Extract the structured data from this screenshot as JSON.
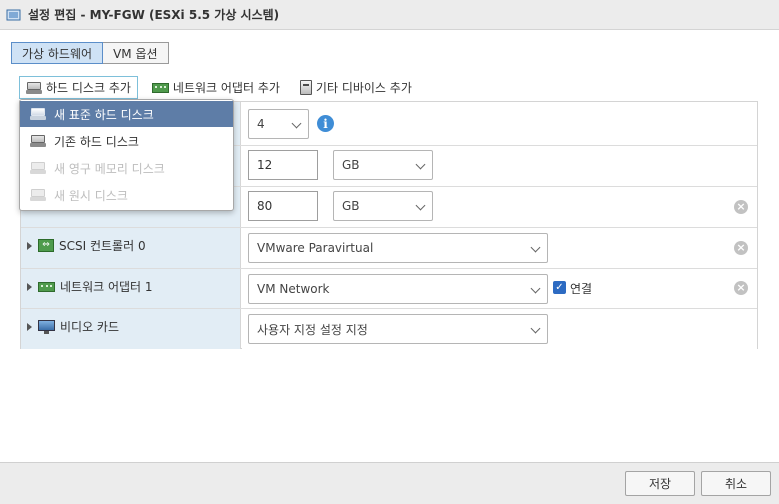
{
  "window": {
    "title": "설정 편집 - MY-FGW (ESXi 5.5 가상 시스템)"
  },
  "tabs": [
    {
      "label": "가상 하드웨어",
      "active": true
    },
    {
      "label": "VM 옵션",
      "active": false
    }
  ],
  "toolbar": {
    "add_disk": "하드 디스크 추가",
    "add_nic": "네트워크 어댑터 추가",
    "add_other": "기타 디바이스 추가"
  },
  "dropdown": {
    "items": [
      {
        "label": "새 표준 하드 디스크",
        "state": "highlighted"
      },
      {
        "label": "기존 하드 디스크",
        "state": "enabled"
      },
      {
        "label": "새 영구 메모리 디스크",
        "state": "disabled"
      },
      {
        "label": "새 원시 디스크",
        "state": "disabled"
      }
    ]
  },
  "rows": {
    "cpu": {
      "value": "4"
    },
    "memory": {
      "value": "12",
      "unit": "GB"
    },
    "disk": {
      "value": "80",
      "unit": "GB"
    },
    "scsi": {
      "label": "SCSI 컨트롤러 0",
      "value": "VMware Paravirtual"
    },
    "nic": {
      "label": "네트워크 어댑터 1",
      "value": "VM Network",
      "connect_label": "연결",
      "connected": true
    },
    "video": {
      "label": "비디오 카드",
      "value": "사용자 지정 설정 지정"
    }
  },
  "footer": {
    "save": "저장",
    "cancel": "취소"
  },
  "colors": {
    "accent": "#5e7da7",
    "tab_active": "#cfe2f5",
    "label_bg": "#e2edf5",
    "info": "#3f8dd6",
    "checkbox": "#2d6bc2"
  }
}
